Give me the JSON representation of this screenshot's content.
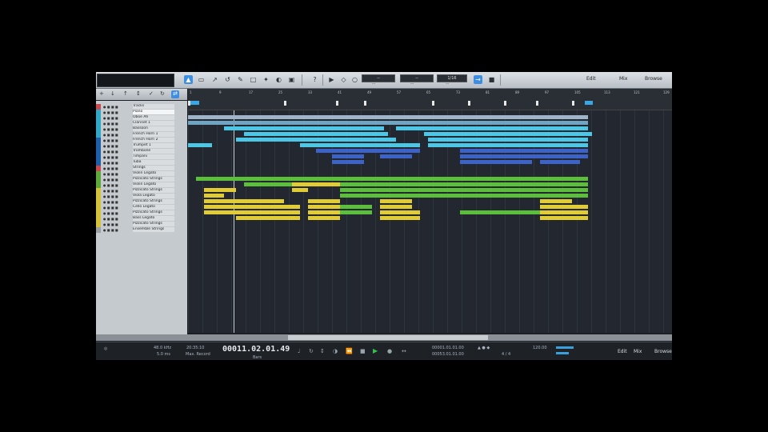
{
  "toolbar": {
    "fields": [
      {
        "value": "--",
        "caption": "---"
      },
      {
        "value": "--",
        "caption": "---"
      },
      {
        "value": "1/16",
        "caption": "---"
      }
    ],
    "right_buttons": [
      "Edit",
      "Mix",
      "Browse"
    ]
  },
  "ruler": {
    "ticks": [
      "1",
      "9",
      "17",
      "25",
      "33",
      "41",
      "49",
      "57",
      "65",
      "73",
      "81",
      "89",
      "97",
      "105",
      "113",
      "121",
      "129"
    ]
  },
  "tracks": {
    "items": [
      {
        "name": "Tracks",
        "color": "#c9494e",
        "selected": false
      },
      {
        "name": "Piano",
        "color": "#2fa8c8",
        "selected": true
      },
      {
        "name": "Oboe Ah",
        "color": "#2fa8c8",
        "selected": false
      },
      {
        "name": "Clarinet 1",
        "color": "#2fa8c8",
        "selected": false
      },
      {
        "name": "Bassoon",
        "color": "#2fa8c8",
        "selected": false
      },
      {
        "name": "French Horn 1",
        "color": "#2fa8c8",
        "selected": false
      },
      {
        "name": "French Horn 2",
        "color": "#1d5fa8",
        "selected": false
      },
      {
        "name": "Trumpet 1",
        "color": "#1d5fa8",
        "selected": false
      },
      {
        "name": "Trombone",
        "color": "#1d5fa8",
        "selected": false
      },
      {
        "name": "Timpani",
        "color": "#1d5fa8",
        "selected": false
      },
      {
        "name": "Tuba",
        "color": "#1d5fa8",
        "selected": false
      },
      {
        "name": "Strings",
        "color": "#c9494e",
        "selected": false
      },
      {
        "name": "Violin Legato",
        "color": "#5fa83a",
        "selected": false
      },
      {
        "name": "Pizzicato Strings",
        "color": "#5fa83a",
        "selected": false
      },
      {
        "name": "Violin Legato",
        "color": "#5fa83a",
        "selected": false
      },
      {
        "name": "Pizzicato Strings",
        "color": "#d6c238",
        "selected": false
      },
      {
        "name": "Viola Legato",
        "color": "#d6c238",
        "selected": false
      },
      {
        "name": "Pizzicato Strings",
        "color": "#d6c238",
        "selected": false
      },
      {
        "name": "Cello Legato",
        "color": "#d6c238",
        "selected": false
      },
      {
        "name": "Pizzicato Strings",
        "color": "#d6c238",
        "selected": false
      },
      {
        "name": "Bass Legato",
        "color": "#d6c238",
        "selected": false
      },
      {
        "name": "Pizzicato Strings",
        "color": "#d6c238",
        "selected": false
      },
      {
        "name": "Ensemble Strings",
        "color": "#9aa0a6",
        "selected": false
      }
    ]
  },
  "transport": {
    "sample_rate": "48.0 kHz",
    "latency": "5.0 ms",
    "record_time": "20:35:10",
    "record_label": "Max. Record",
    "time_display": "00011.02.01.49",
    "time_unit": "Bars",
    "loop_start": "00001.01.01.00",
    "loop_end": "00053.01.01.00",
    "tempo": "120.00",
    "signature": "4 / 4",
    "right_buttons": [
      "Edit",
      "Mix",
      "Browse"
    ]
  },
  "colors": {
    "cyan": "#4cc7e6",
    "blue": "#3e63c8",
    "green": "#5cbf3c",
    "yellow": "#e2cc36",
    "accent": "#3d8ee0"
  }
}
